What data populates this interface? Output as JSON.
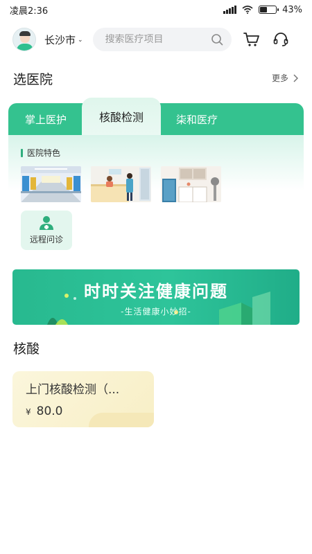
{
  "status_bar": {
    "time": "凌晨2:36",
    "battery": "43%",
    "battery_level": 0.43
  },
  "header": {
    "city": "长沙市",
    "search_placeholder": "搜索医疗项目"
  },
  "hospital_section": {
    "title": "选医院",
    "more_label": "更多",
    "tabs": [
      {
        "label": "掌上医护"
      },
      {
        "label": "核酸检测",
        "active": true
      },
      {
        "label": "柒和医疗"
      }
    ],
    "feature_label": "医院特色",
    "service_label": "远程问诊"
  },
  "banner": {
    "title": "时时关注健康问题",
    "subtitle": "-生活健康小妙招-"
  },
  "nucleic_section": {
    "title": "核酸",
    "product": {
      "title": "上门核酸检测（...",
      "currency": "¥",
      "price": "80.0"
    }
  },
  "colors": {
    "accent": "#34c28f",
    "banner": "#2ec49a",
    "product_bg": "#f8efc6"
  }
}
